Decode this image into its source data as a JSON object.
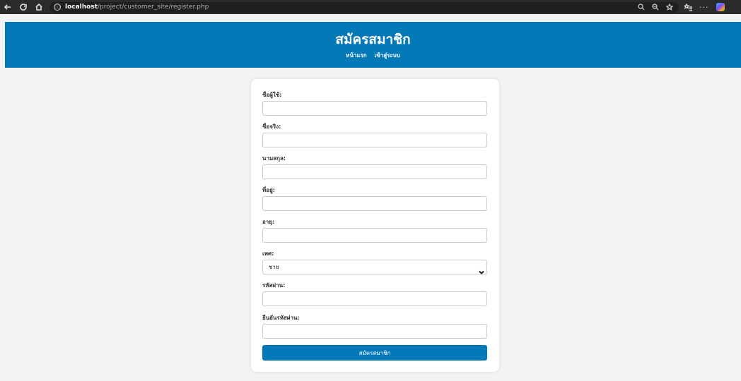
{
  "browser": {
    "url_host": "localhost",
    "url_path": "/project/customer_site/register.php",
    "info_icon": "ⓘ"
  },
  "header": {
    "title": "สมัครสมาชิก",
    "nav": [
      "หน้าแรก",
      "เข้าสู่ระบบ"
    ],
    "background": "#0479b7"
  },
  "form": {
    "fields": [
      {
        "label": "ชื่อผู้ใช้:",
        "value": ""
      },
      {
        "label": "ชื่อจริง:",
        "value": ""
      },
      {
        "label": "นามสกุล:",
        "value": ""
      },
      {
        "label": "ที่อยู่:",
        "value": ""
      },
      {
        "label": "อายุ:",
        "value": ""
      },
      {
        "label": "เพศ:",
        "selected": "ชาย"
      },
      {
        "label": "รหัสผ่าน:",
        "value": ""
      },
      {
        "label": "ยืนยันรหัสผ่าน:",
        "value": ""
      }
    ],
    "submit_label": "สมัครสมาชิก"
  },
  "icons": [
    "back-icon",
    "refresh-icon",
    "home-icon",
    "info-icon",
    "search-icon",
    "zoom-icon",
    "favorite-star-icon",
    "favorites-list-icon",
    "more-icon",
    "copilot-icon"
  ]
}
